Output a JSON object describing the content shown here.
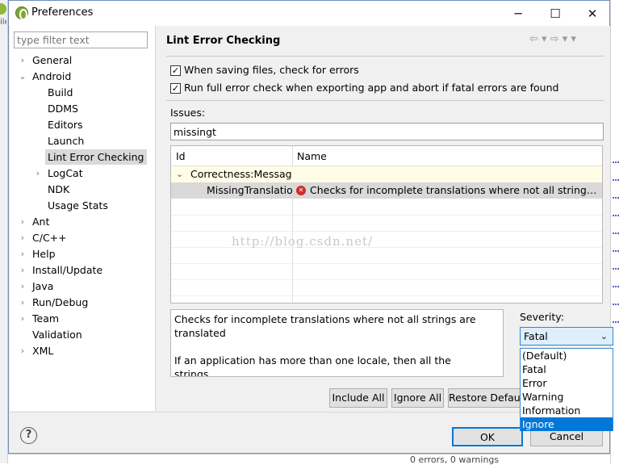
{
  "window": {
    "title": "Preferences",
    "minimize": "─",
    "maximize": "☐",
    "close": "✕"
  },
  "filter": {
    "placeholder": "type filter text"
  },
  "tree": {
    "general": "General",
    "android": "Android",
    "build": "Build",
    "ddms": "DDMS",
    "editors": "Editors",
    "launch": "Launch",
    "lint": "Lint Error Checking",
    "logcat": "LogCat",
    "ndk": "NDK",
    "usage": "Usage Stats",
    "ant": "Ant",
    "cpp": "C/C++",
    "help": "Help",
    "install": "Install/Update",
    "java": "Java",
    "rundebug": "Run/Debug",
    "team": "Team",
    "validation": "Validation",
    "xml": "XML"
  },
  "page": {
    "title": "Lint Error Checking",
    "nav": "⇦ ▾ ⇨ ▾  ▾",
    "check_saving": "When saving files, check for errors",
    "check_export": "Run full error check when exporting app and abort if fatal errors are found",
    "issues_label": "Issues:",
    "issues_value": "missingt"
  },
  "table": {
    "col_id": "Id",
    "col_name": "Name",
    "group": "Correctness:Messages",
    "issue_id": "MissingTranslation",
    "issue_name": "Checks for incomplete translations where not all strings are translated"
  },
  "watermark": "http://blog.csdn.net/",
  "description": {
    "line1": "Checks for incomplete translations where not all strings are translated",
    "line2": "If an application has more than one locale, then all the strings"
  },
  "severity": {
    "label": "Severity:",
    "selected": "Fatal",
    "options": [
      "(Default)",
      "Fatal",
      "Error",
      "Warning",
      "Information",
      "Ignore"
    ]
  },
  "buttons": {
    "include_all": "Include All",
    "ignore_all": "Ignore All",
    "restore_defaults": "Restore Defaults",
    "ok": "OK",
    "cancel": "Cancel",
    "help": "?"
  },
  "background": {
    "status": "0 errors, 0 warnings"
  },
  "colors": {
    "accent": "#0078d7",
    "selection": "#d9d9d9",
    "group_row": "#fffde6",
    "error": "#d42b2b"
  }
}
